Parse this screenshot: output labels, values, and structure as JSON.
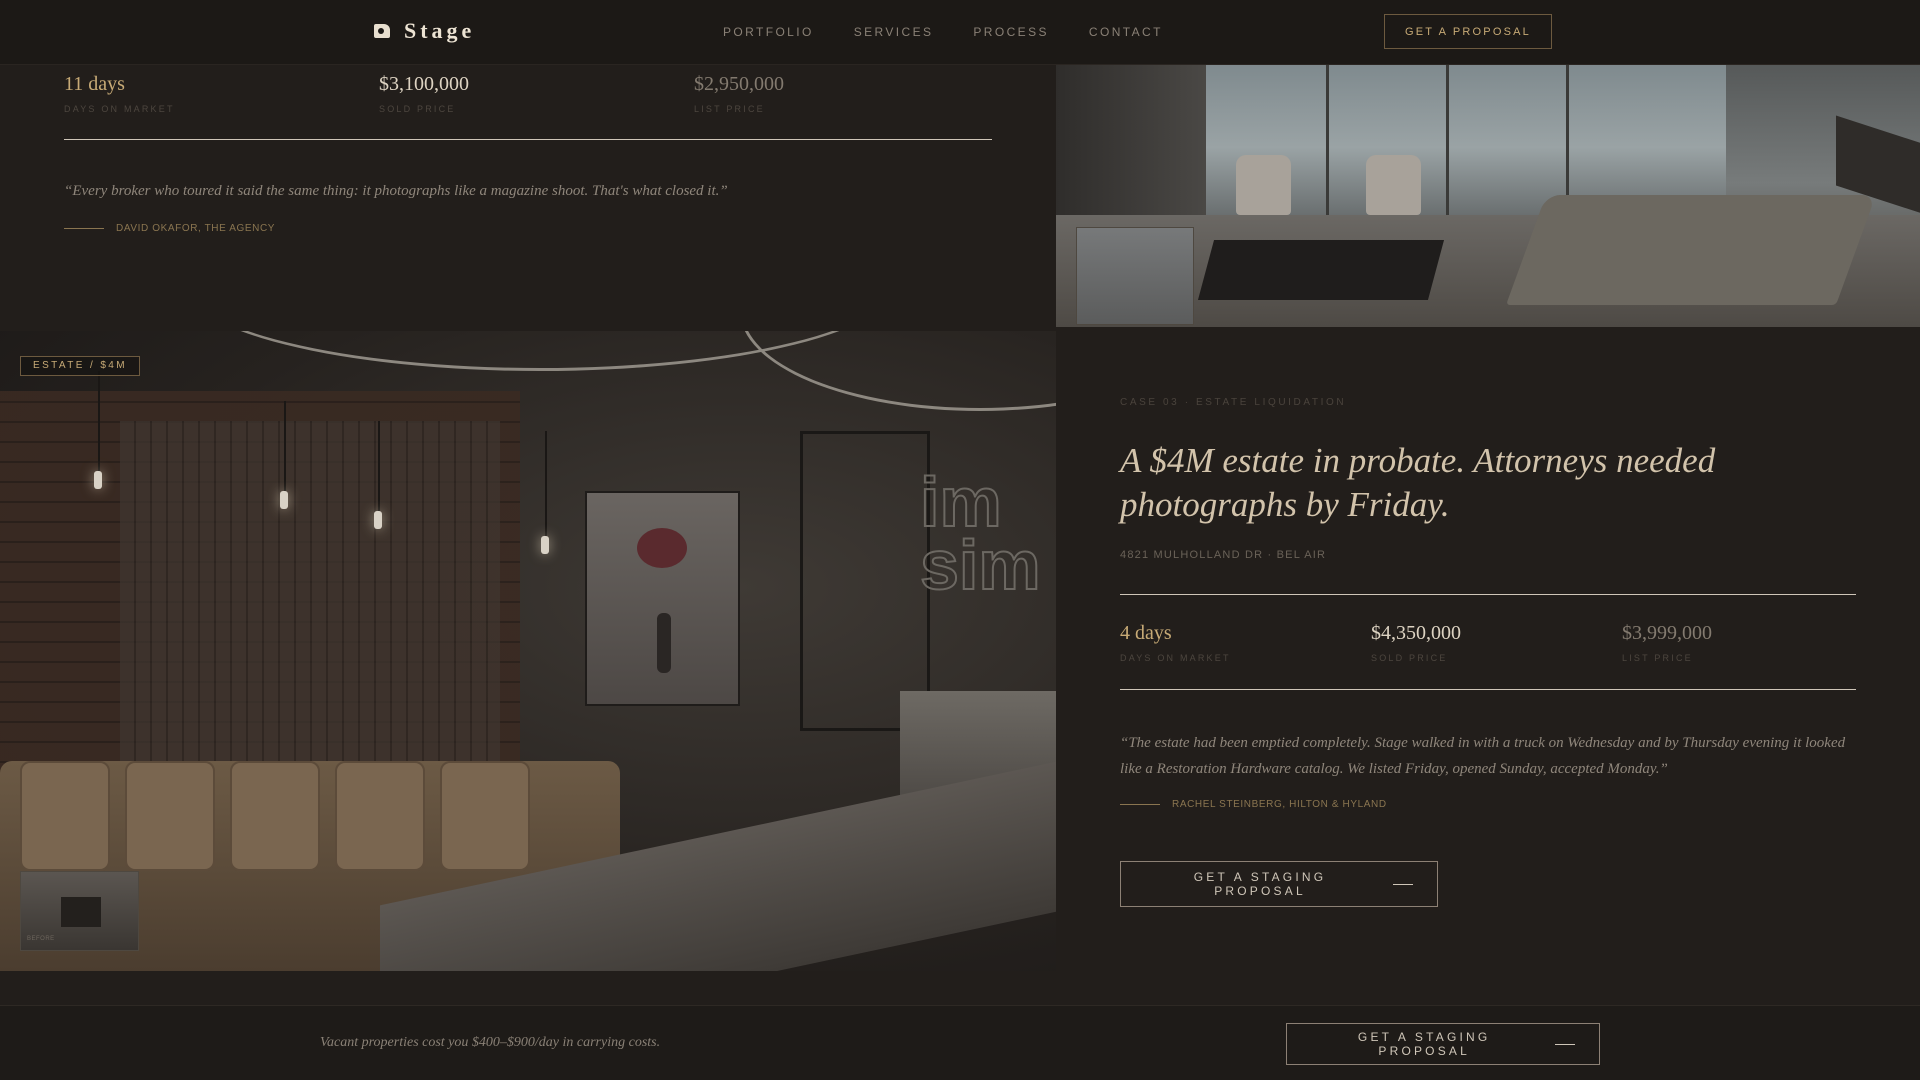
{
  "nav": {
    "logo_text": "Stage",
    "links": [
      "PORTFOLIO",
      "SERVICES",
      "PROCESS",
      "CONTACT"
    ],
    "cta": "GET A PROPOSAL"
  },
  "case_prev": {
    "stats": [
      {
        "value": "11 days",
        "label": "DAYS ON MARKET"
      },
      {
        "value": "$3,100,000",
        "label": "SOLD PRICE"
      },
      {
        "value": "$2,950,000",
        "label": "LIST PRICE"
      }
    ],
    "quote": "“Every broker who toured it said the same thing: it photographs like a magazine shoot. That's what closed it.”",
    "attribution": "DAVID OKAFOR, THE AGENCY"
  },
  "case_current": {
    "badge": "ESTATE / $4M",
    "thumb_caption": "BEFORE",
    "eyebrow": "CASE 03 · ESTATE LIQUIDATION",
    "title": "A $4M estate in probate. Attorneys needed photographs by Friday.",
    "address": "4821 MULHOLLAND DR · BEL AIR",
    "stats": [
      {
        "value": "4 days",
        "label": "DAYS ON MARKET"
      },
      {
        "value": "$4,350,000",
        "label": "SOLD PRICE"
      },
      {
        "value": "$3,999,000",
        "label": "LIST PRICE"
      }
    ],
    "quote": "“The estate had been emptied completely. Stage walked in with a truck on Wednesday and by Thursday evening it looked like a Restoration Hardware catalog. We listed Friday, opened Sunday, accepted Monday.”",
    "attribution": "RACHEL STEINBERG, HILTON & HYLAND",
    "cta": "GET A STAGING PROPOSAL"
  },
  "footer": {
    "note": "Vacant properties cost you $400–$900/day in carrying costs.",
    "cta": "GET A STAGING PROPOSAL"
  },
  "colors": {
    "background": "#221e1b",
    "accent_gold": "#c7aa76",
    "text": "#cfc6b8"
  }
}
